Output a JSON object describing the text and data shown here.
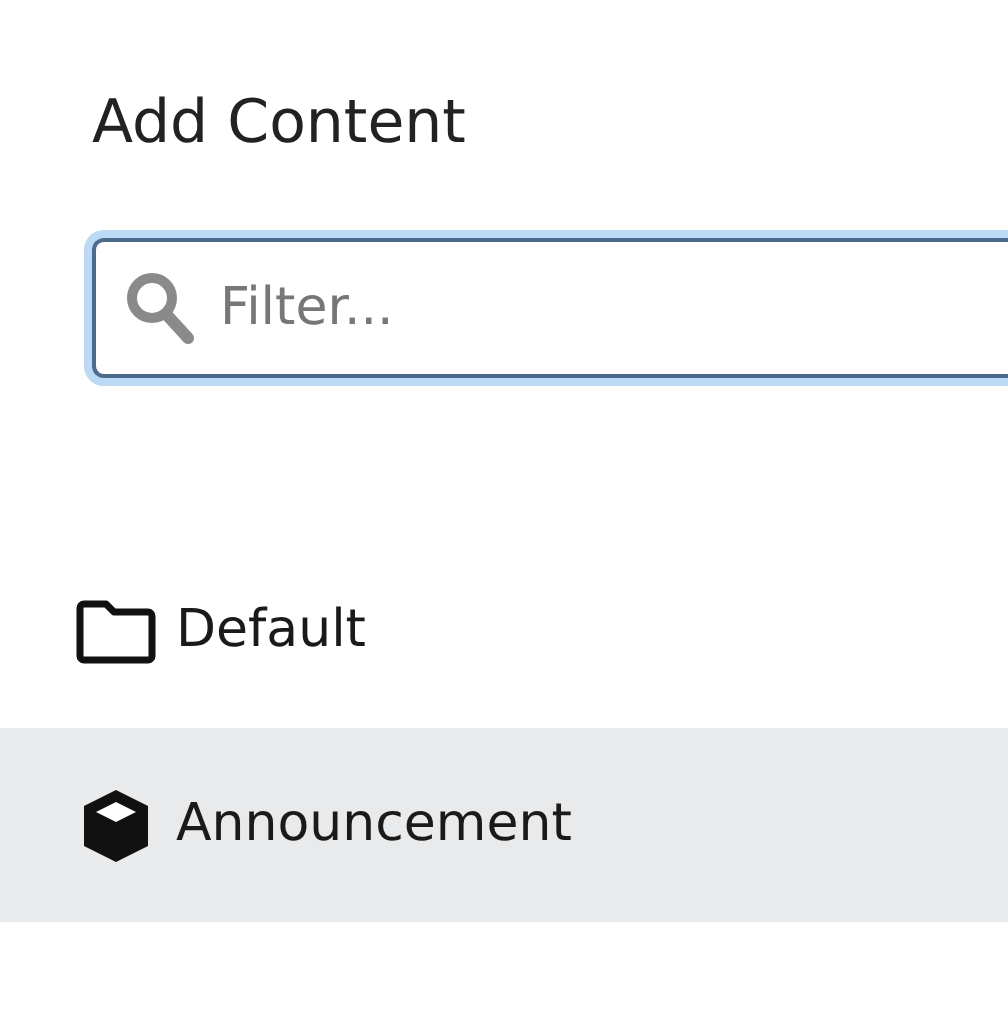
{
  "title": "Add Content",
  "filter": {
    "placeholder": "Filter..."
  },
  "items": [
    {
      "label": "Default",
      "kind": "folder",
      "selected": false
    },
    {
      "label": "Announcement",
      "kind": "cube",
      "selected": true
    }
  ]
}
